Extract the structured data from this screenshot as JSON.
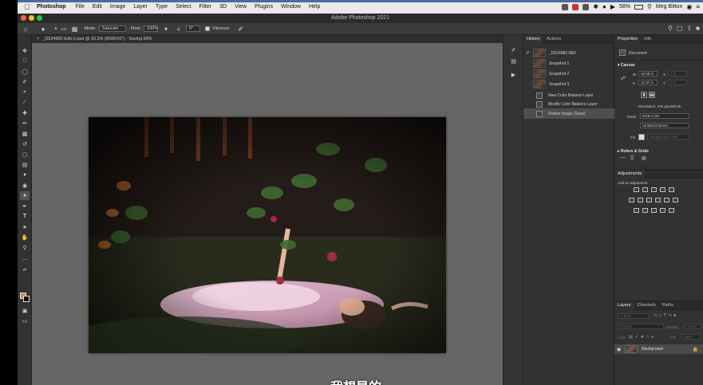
{
  "menubar": {
    "app": "Photoshop",
    "items": [
      "File",
      "Edit",
      "Image",
      "Layer",
      "Type",
      "Select",
      "Filter",
      "3D",
      "View",
      "Plugins",
      "Window",
      "Help"
    ],
    "battery": "58%",
    "user": "Meg Bitton"
  },
  "window": {
    "title": "Adobe Photoshop 2021"
  },
  "options": {
    "mode_label": "Mode:",
    "mode_value": "Saturate",
    "flow_label": "Flow:",
    "flow_value": "100%",
    "angle_value": "0°",
    "vibrance_label": "Vibrance",
    "brush_size": "100"
  },
  "document": {
    "tab": "_D524982-Edit-2.psd @ 33.3% (RGB/16*) - Saving 99%"
  },
  "subtitle": "我想是的",
  "history": {
    "tabs": [
      "History",
      "Actions"
    ],
    "source": "_D524982.NEF",
    "snapshots": [
      "Snapshot 1",
      "Snapshot 2",
      "Snapshot 3"
    ],
    "steps": [
      "New Color Balance Layer",
      "Modify Color Balance Layer",
      "Flatten Image (Save)"
    ]
  },
  "properties": {
    "tabs": [
      "Properties",
      "Info"
    ],
    "kind": "Document",
    "canvas": {
      "title": "Canvas",
      "w_label": "W",
      "w_value": "18.56 in",
      "h_label": "H",
      "h_value": "12.37 in",
      "x_label": "X",
      "y_label": "Y",
      "x_value": "0 in",
      "y_value": "0 in",
      "resolution": "Resolution: 300 pixels/inch",
      "mode_label": "Mode",
      "mode_value": "RGB Color",
      "depth_value": "16 Bits/Channel",
      "fill_label": "Fill",
      "fill_value": "Background Color"
    },
    "rulers_title": "Rulers & Grids"
  },
  "adjustments": {
    "title": "Adjustments",
    "hint": "Add an adjustment"
  },
  "layers": {
    "tabs": [
      "Layers",
      "Channels",
      "Paths"
    ],
    "kind_filter": "Kind",
    "blend": "Normal",
    "opacity_label": "Opacity:",
    "opacity_value": "100%",
    "lock_label": "Lock:",
    "fill_label": "Fill:",
    "fill_value": "100%",
    "background": "Background"
  },
  "colors": {
    "foreground": "#c28a5a",
    "background": "#111111",
    "accent": "#4a6aa0"
  }
}
